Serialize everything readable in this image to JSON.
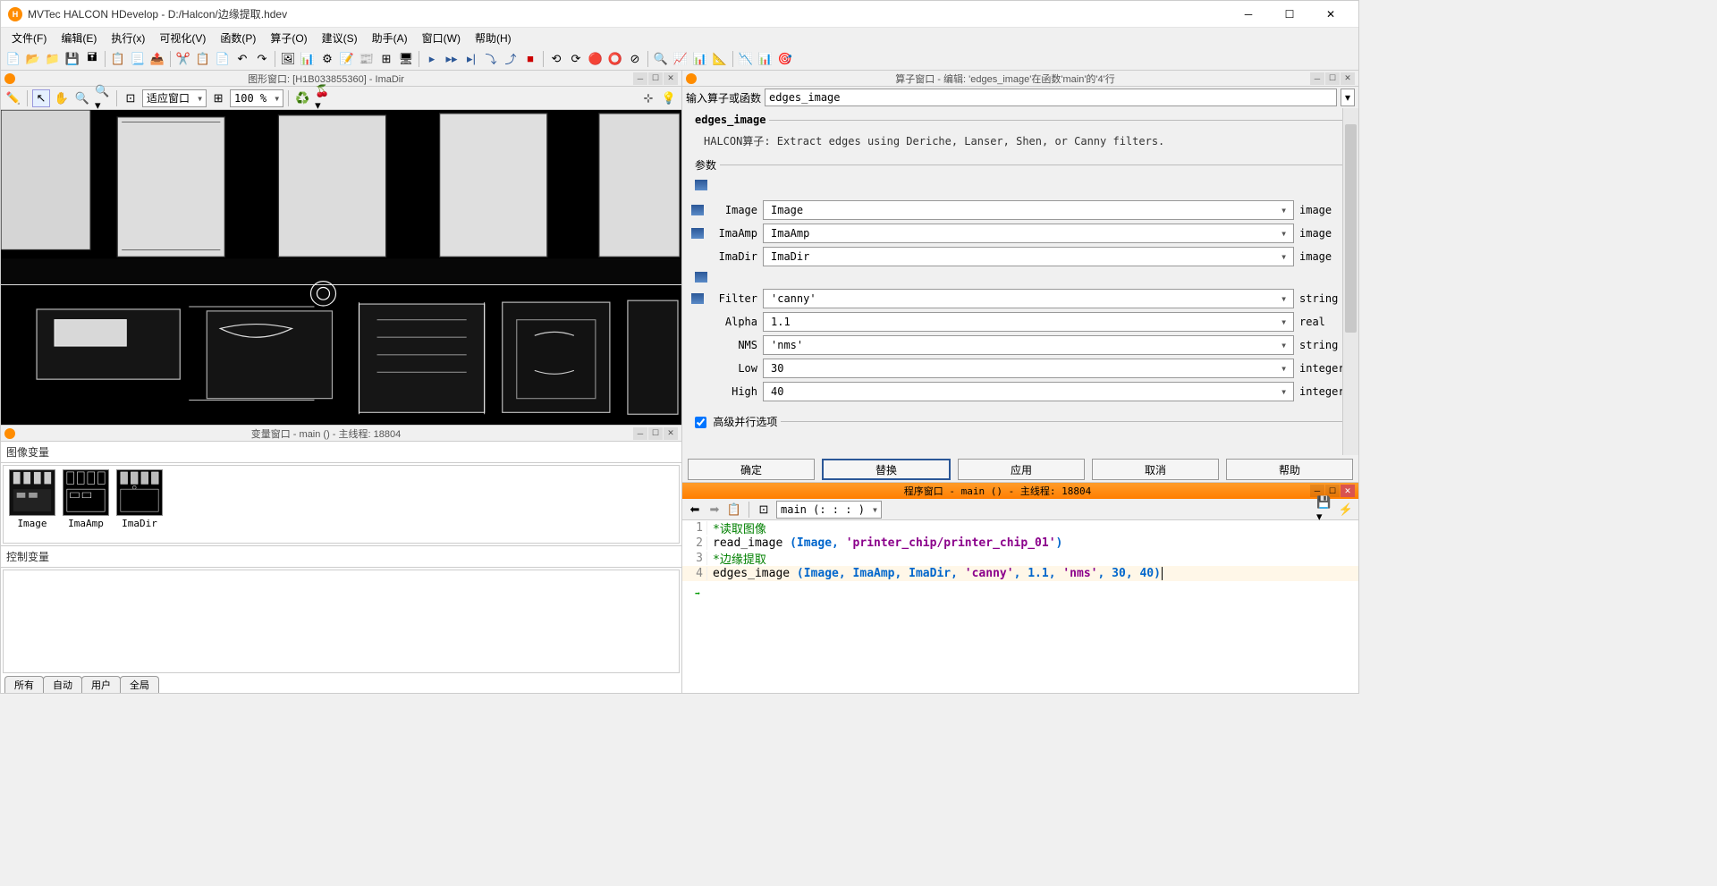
{
  "title": "MVTec HALCON HDevelop - D:/Halcon/边缘提取.hdev",
  "menu": [
    "文件(F)",
    "编辑(E)",
    "执行(x)",
    "可视化(V)",
    "函数(P)",
    "算子(O)",
    "建议(S)",
    "助手(A)",
    "窗口(W)",
    "帮助(H)"
  ],
  "graphics_window": {
    "title": "图形窗口: [H1B033855360] - ImaDir",
    "fit_label": "适应窗口",
    "zoom": "100 %"
  },
  "variable_window": {
    "title": "变量窗口 - main () - 主线程: 18804",
    "section_image": "图像变量",
    "section_ctrl": "控制变量",
    "thumbs": [
      "Image",
      "ImaAmp",
      "ImaDir"
    ],
    "tabs": [
      "所有",
      "自动",
      "用户",
      "全局"
    ]
  },
  "operator_window": {
    "title": "算子窗口 - 编辑:  'edges_image'在函数'main'的'4'行",
    "input_label": "输入算子或函数",
    "input_value": "edges_image",
    "op_name": "edges_image",
    "op_desc": "HALCON算子: Extract edges using Deriche, Lanser, Shen, or Canny filters.",
    "params_label": "参数",
    "params": [
      {
        "icon": "in",
        "name": "Image",
        "value": "Image",
        "type": "image"
      },
      {
        "icon": "in",
        "name": "ImaAmp",
        "value": "ImaAmp",
        "type": "image"
      },
      {
        "icon": "",
        "name": "ImaDir",
        "value": "ImaDir",
        "type": "image"
      },
      {
        "icon": "in",
        "name": "Filter",
        "value": "'canny'",
        "type": "string"
      },
      {
        "icon": "",
        "name": "Alpha",
        "value": "1.1",
        "type": "real"
      },
      {
        "icon": "",
        "name": "NMS",
        "value": "'nms'",
        "type": "string"
      },
      {
        "icon": "",
        "name": "Low",
        "value": "30",
        "type": "integer"
      },
      {
        "icon": "",
        "name": "High",
        "value": "40",
        "type": "integer"
      }
    ],
    "advanced": "高级并行选项",
    "buttons": {
      "ok": "确定",
      "replace": "替换",
      "apply": "应用",
      "cancel": "取消",
      "help": "帮助"
    }
  },
  "program_window": {
    "title": "程序窗口 - main () - 主线程: 18804",
    "func": "main (: : : )",
    "lines": [
      {
        "n": 1,
        "type": "comment",
        "text": "*读取图像"
      },
      {
        "n": 2,
        "type": "call",
        "fn": "read_image",
        "args": "(Image, 'printer_chip/printer_chip_01')"
      },
      {
        "n": 3,
        "type": "comment",
        "text": "*边缘提取"
      },
      {
        "n": 4,
        "type": "call",
        "fn": "edges_image",
        "args": "(Image, ImaAmp, ImaDir, 'canny', 1.1, 'nms', 30, 40)",
        "current": true
      }
    ]
  }
}
